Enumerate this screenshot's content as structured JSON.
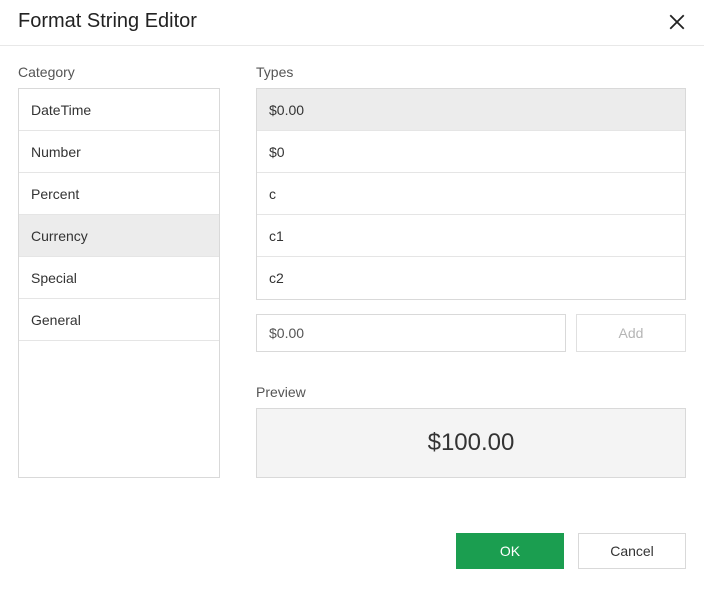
{
  "header": {
    "title": "Format String Editor"
  },
  "category": {
    "label": "Category",
    "items": [
      {
        "label": "DateTime",
        "selected": false
      },
      {
        "label": "Number",
        "selected": false
      },
      {
        "label": "Percent",
        "selected": false
      },
      {
        "label": "Currency",
        "selected": true
      },
      {
        "label": "Special",
        "selected": false
      },
      {
        "label": "General",
        "selected": false
      }
    ]
  },
  "types": {
    "label": "Types",
    "items": [
      {
        "label": "$0.00",
        "selected": true
      },
      {
        "label": "$0",
        "selected": false
      },
      {
        "label": "c",
        "selected": false
      },
      {
        "label": "c1",
        "selected": false
      },
      {
        "label": "c2",
        "selected": false
      }
    ],
    "input_value": "$0.00",
    "add_label": "Add"
  },
  "preview": {
    "label": "Preview",
    "value": "$100.00"
  },
  "footer": {
    "ok_label": "OK",
    "cancel_label": "Cancel"
  }
}
